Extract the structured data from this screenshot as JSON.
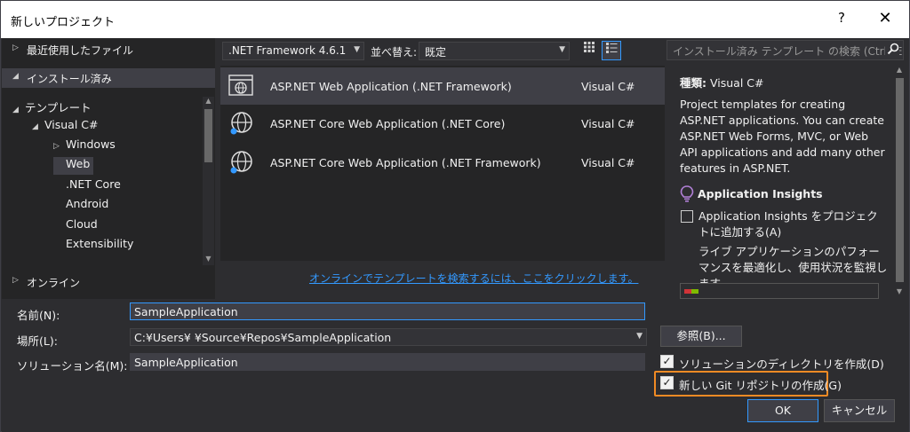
{
  "window": {
    "title": "新しいプロジェクト",
    "help": "?",
    "close": "✕"
  },
  "left": {
    "recent": {
      "arrow": "▷",
      "label": "最近使用したファイル"
    },
    "installed": {
      "arrow": "◢",
      "label": "インストール済み"
    },
    "tree": [
      {
        "arrow": "◢",
        "label": "テンプレート"
      },
      {
        "arrow": "◢",
        "label": "Visual C#"
      },
      {
        "arrow": "▷",
        "label": "Windows"
      },
      {
        "arrow": "",
        "label": "Web"
      },
      {
        "arrow": "",
        "label": ".NET Core"
      },
      {
        "arrow": "",
        "label": "Android"
      },
      {
        "arrow": "",
        "label": "Cloud"
      },
      {
        "arrow": "",
        "label": "Extensibility"
      }
    ],
    "online": {
      "arrow": "▷",
      "label": "オンライン"
    }
  },
  "toolbar": {
    "framework": ".NET Framework 4.6.1",
    "sort_label": "並べ替え:",
    "sort_value": "既定",
    "search_placeholder": "インストール済み テンプレート の検索 (Ctrl+E",
    "icons": {
      "grid": "grid-view-icon",
      "list": "list-view-icon",
      "search": "search-icon"
    }
  },
  "templates": [
    {
      "name": "ASP.NET Web Application (.NET Framework)",
      "lang": "Visual C#",
      "icon": "web-app-icon"
    },
    {
      "name": "ASP.NET Core Web Application (.NET Core)",
      "lang": "Visual C#",
      "icon": "core-web-app-icon"
    },
    {
      "name": "ASP.NET Core Web Application (.NET Framework)",
      "lang": "Visual C#",
      "icon": "core-web-app-icon"
    }
  ],
  "online_link": "オンラインでテンプレートを検索するには、ここをクリックします。",
  "details": {
    "type_label": "種類:",
    "type_value": "Visual C#",
    "description": "Project templates for creating ASP.NET applications. You can create ASP.NET Web Forms, MVC, or Web API applications and add many other features in ASP.NET.",
    "insights_title": "Application Insights",
    "insights_checkbox": "Application Insights をプロジェクトに追加する(A)",
    "insights_desc": "ライブ アプリケーションのパフォーマンスを最適化し、使用状況を監視します。"
  },
  "form": {
    "name_label": "名前(N):",
    "name_value": "SampleApplication",
    "location_label": "場所(L):",
    "location_value": "C:¥Users¥          ¥Source¥Repos¥SampleApplication",
    "solution_label": "ソリューション名(M):",
    "solution_value": "SampleApplication",
    "browse": "参照(B)...",
    "create_dir": "ソリューションのディレクトリを作成(D)",
    "create_git": "新しい Git リポジトリの作成(G)",
    "check": "✓",
    "ok": "OK",
    "cancel": "キャンセル"
  },
  "colors": {
    "accent": "#3399ff",
    "highlight": "#f08a24",
    "background": "#2d2d30"
  }
}
